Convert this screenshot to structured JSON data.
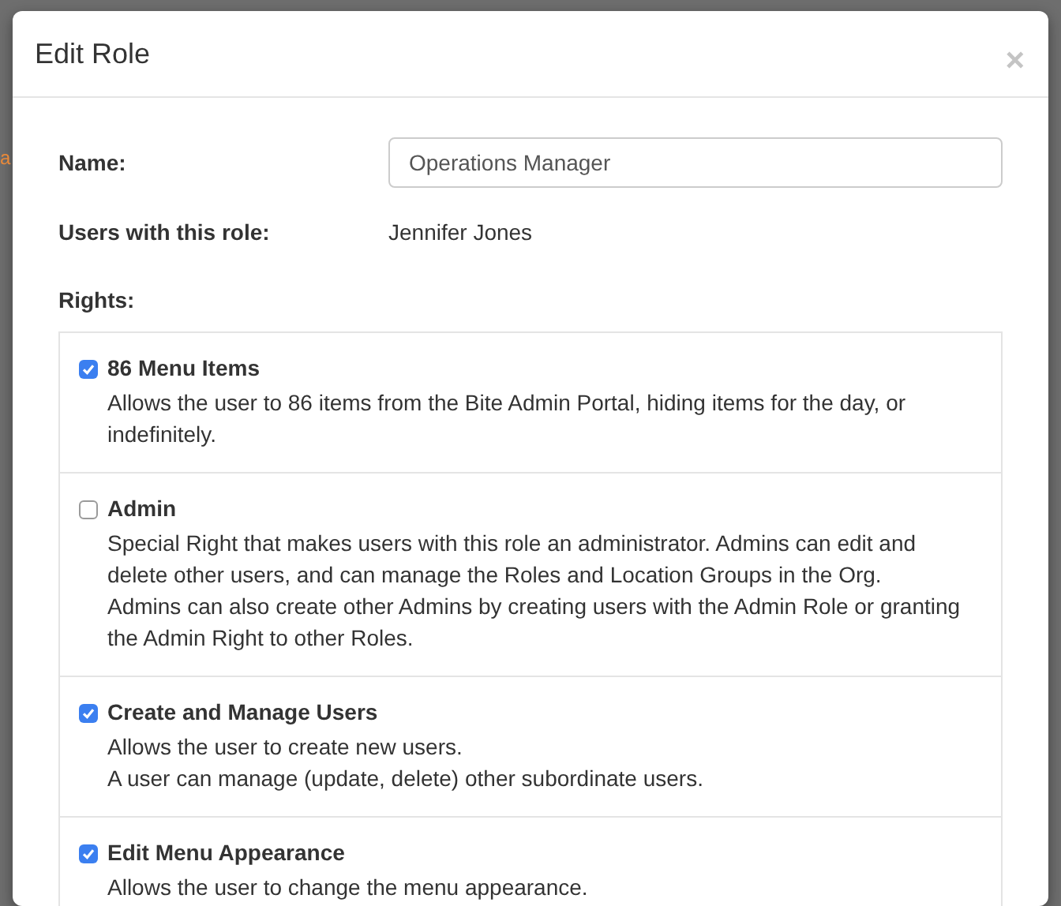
{
  "background": {
    "text_fragment": "a"
  },
  "dialog": {
    "title": "Edit Role",
    "close": "×"
  },
  "form": {
    "name_label": "Name:",
    "name_value": "Operations Manager",
    "users_label": "Users with this role:",
    "users_value": "Jennifer Jones",
    "rights_label": "Rights:"
  },
  "rights": [
    {
      "title": "86 Menu Items",
      "checked": true,
      "description": [
        "Allows the user to 86 items from the Bite Admin Portal, hiding items for the day, or indefinitely."
      ]
    },
    {
      "title": "Admin",
      "checked": false,
      "description": [
        "Special Right that makes users with this role an administrator. Admins can edit and delete other users, and can manage the Roles and Location Groups in the Org.",
        "Admins can also create other Admins by creating users with the Admin Role or granting the Admin Right to other Roles."
      ]
    },
    {
      "title": "Create and Manage Users",
      "checked": true,
      "description": [
        "Allows the user to create new users.",
        "A user can manage (update, delete) other subordinate users."
      ]
    },
    {
      "title": "Edit Menu Appearance",
      "checked": true,
      "description": [
        "Allows the user to change the menu appearance."
      ]
    }
  ]
}
